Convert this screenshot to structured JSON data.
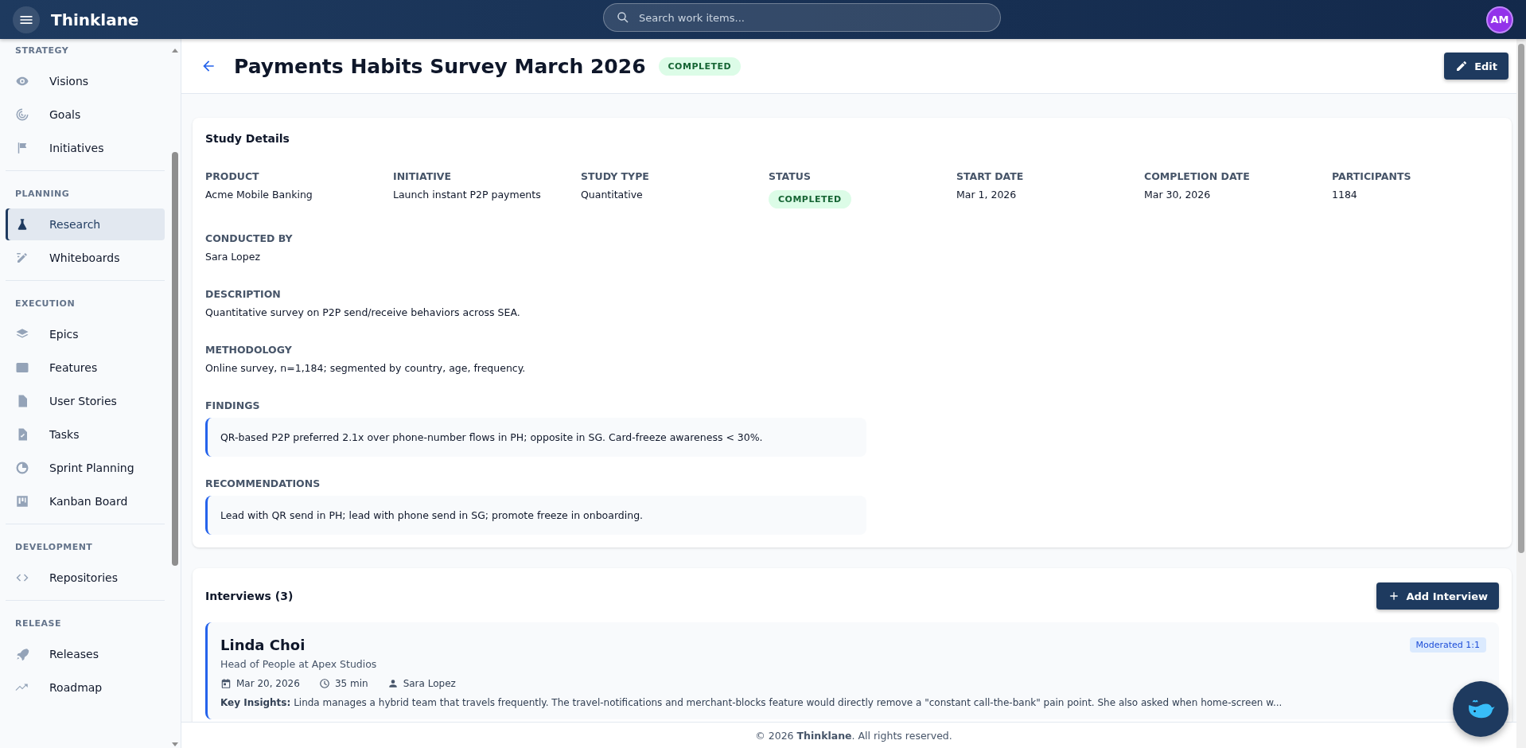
{
  "app": {
    "name": "Thinklane",
    "user_initials": "AM"
  },
  "search": {
    "placeholder": "Search work items..."
  },
  "sidebar": {
    "sections": [
      {
        "title": "STRATEGY",
        "items": [
          {
            "label": "Visions",
            "selected": false
          },
          {
            "label": "Goals",
            "selected": false
          },
          {
            "label": "Initiatives",
            "selected": false
          }
        ]
      },
      {
        "title": "PLANNING",
        "items": [
          {
            "label": "Research",
            "selected": true
          },
          {
            "label": "Whiteboards",
            "selected": false
          }
        ]
      },
      {
        "title": "EXECUTION",
        "items": [
          {
            "label": "Epics",
            "selected": false
          },
          {
            "label": "Features",
            "selected": false
          },
          {
            "label": "User Stories",
            "selected": false
          },
          {
            "label": "Tasks",
            "selected": false
          },
          {
            "label": "Sprint Planning",
            "selected": false
          },
          {
            "label": "Kanban Board",
            "selected": false
          }
        ]
      },
      {
        "title": "DEVELOPMENT",
        "items": [
          {
            "label": "Repositories",
            "selected": false
          }
        ]
      },
      {
        "title": "RELEASE",
        "items": [
          {
            "label": "Releases",
            "selected": false
          },
          {
            "label": "Roadmap",
            "selected": false
          }
        ]
      }
    ]
  },
  "page": {
    "title": "Payments Habits Survey March 2026",
    "status": "COMPLETED",
    "edit_button": "Edit"
  },
  "study_details": {
    "title": "Study Details",
    "fields": [
      {
        "label": "PRODUCT",
        "value": "Acme Mobile Banking",
        "kind": "text"
      },
      {
        "label": "INITIATIVE",
        "value": "Launch instant P2P payments",
        "kind": "text"
      },
      {
        "label": "STUDY TYPE",
        "value": "Quantitative",
        "kind": "text"
      },
      {
        "label": "STATUS",
        "value": "COMPLETED",
        "kind": "badge"
      },
      {
        "label": "START DATE",
        "value": "Mar 1, 2026",
        "kind": "text"
      },
      {
        "label": "COMPLETION DATE",
        "value": "Mar 30, 2026",
        "kind": "text"
      },
      {
        "label": "PARTICIPANTS",
        "value": "1184",
        "kind": "text"
      }
    ],
    "blocks": [
      {
        "label": "CONDUCTED BY",
        "value": "Sara Lopez",
        "kind": "text"
      },
      {
        "label": "DESCRIPTION",
        "value": "Quantitative survey on P2P send/receive behaviors across SEA.",
        "kind": "text"
      },
      {
        "label": "METHODOLOGY",
        "value": "Online survey, n=1,184; segmented by country, age, frequency.",
        "kind": "text"
      },
      {
        "label": "FINDINGS",
        "value": "QR-based P2P preferred 2.1x over phone-number flows in PH; opposite in SG. Card-freeze awareness < 30%.",
        "kind": "quote"
      },
      {
        "label": "RECOMMENDATIONS",
        "value": "Lead with QR send in PH; lead with phone send in SG; promote freeze in onboarding.",
        "kind": "quote"
      }
    ]
  },
  "interviews": {
    "title": "Interviews (3)",
    "add_button": "Add Interview",
    "items": [
      {
        "name": "Linda Choi",
        "role": "Head of People at Apex Studios",
        "type": "Moderated 1:1",
        "date": "Mar 20, 2026",
        "duration": "35 min",
        "interviewer": "Sara Lopez",
        "insights": "**Key Insights:** Linda manages a hybrid team that travels frequently. The travel-notifications and merchant-blocks feature would directly remove a \"constant call-the-bank\" pain point. She also asked when home-screen w..."
      }
    ]
  },
  "footer": {
    "text": "© 2026 **Thinklane**. All rights reserved."
  }
}
